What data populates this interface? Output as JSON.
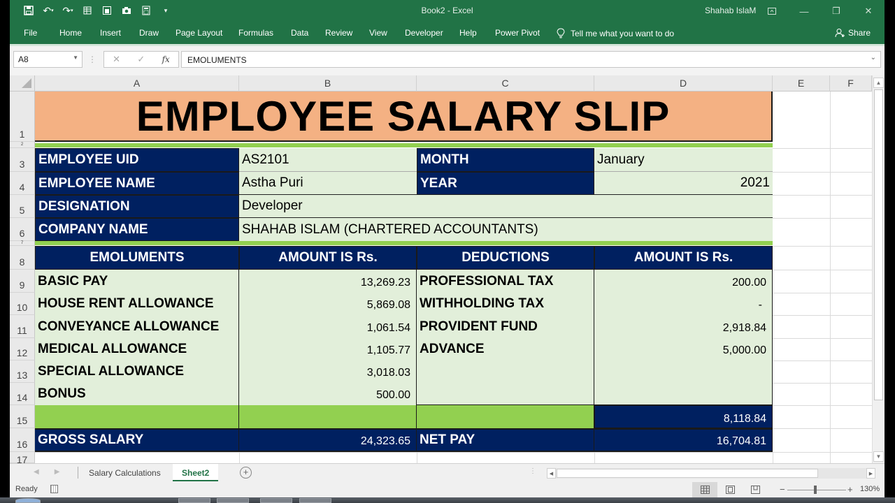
{
  "titlebar": {
    "doc_title": "Book2  -  Excel",
    "user": "Shahab IslaM",
    "qat_icons": [
      "save-icon",
      "undo-icon",
      "redo-icon",
      "form-icon",
      "sheet-view-icon",
      "camera-icon",
      "calculator-icon",
      "customize-qat-icon"
    ]
  },
  "ribbon": {
    "tabs": [
      "File",
      "Home",
      "Insert",
      "Draw",
      "Page Layout",
      "Formulas",
      "Data",
      "Review",
      "View",
      "Developer",
      "Help",
      "Power Pivot"
    ],
    "tell_me": "Tell me what you want to do",
    "share": "Share"
  },
  "formula_bar": {
    "name_box": "A8",
    "formula": "EMOLUMENTS",
    "fx_label": "fx"
  },
  "columns": [
    "A",
    "B",
    "C",
    "D",
    "E",
    "F"
  ],
  "rows": [
    "1",
    "2",
    "3",
    "4",
    "5",
    "6",
    "7",
    "8",
    "9",
    "10",
    "11",
    "12",
    "13",
    "14",
    "15",
    "16",
    "17"
  ],
  "sheet": {
    "title": "EMPLOYEE SALARY SLIP",
    "info": {
      "employee_uid_label": "EMPLOYEE UID",
      "employee_uid": "AS2101",
      "employee_name_label": "EMPLOYEE NAME",
      "employee_name": "Astha Puri",
      "designation_label": "DESIGNATION",
      "designation": "Developer",
      "company_label": "COMPANY NAME",
      "company": "SHAHAB ISLAM (CHARTERED ACCOUNTANTS)",
      "month_label": "MONTH",
      "month": "January",
      "year_label": "YEAR",
      "year": "2021"
    },
    "headers": {
      "emoluments": "EMOLUMENTS",
      "amount1": "AMOUNT IS Rs.",
      "deductions": "DEDUCTIONS",
      "amount2": "AMOUNT IS Rs."
    },
    "emoluments": [
      {
        "label": "BASIC PAY",
        "amount": "13,269.23"
      },
      {
        "label": "HOUSE RENT ALLOWANCE",
        "amount": "5,869.08"
      },
      {
        "label": "CONVEYANCE ALLOWANCE",
        "amount": "1,061.54"
      },
      {
        "label": "MEDICAL ALLOWANCE",
        "amount": "1,105.77"
      },
      {
        "label": "SPECIAL ALLOWANCE",
        "amount": "3,018.03"
      },
      {
        "label": "BONUS",
        "amount": "500.00"
      }
    ],
    "deductions": [
      {
        "label": "PROFESSIONAL TAX",
        "amount": "200.00"
      },
      {
        "label": "WITHHOLDING TAX",
        "amount": "-"
      },
      {
        "label": "PROVIDENT FUND",
        "amount": "2,918.84"
      },
      {
        "label": "ADVANCE",
        "amount": "5,000.00"
      }
    ],
    "total_deductions": "8,118.84",
    "gross_salary_label": "GROSS SALARY",
    "gross_salary": "24,323.65",
    "net_pay_label": "NET PAY",
    "net_pay": "16,704.81"
  },
  "sheet_tabs": [
    "Salary Calculations",
    "Sheet2"
  ],
  "active_sheet": "Sheet2",
  "status": {
    "ready": "Ready",
    "zoom": "130%"
  },
  "colors": {
    "excel_green": "#217346",
    "navy": "#002060",
    "light_green": "#e2efda",
    "bright_green": "#92d050",
    "peach": "#f4b183"
  }
}
